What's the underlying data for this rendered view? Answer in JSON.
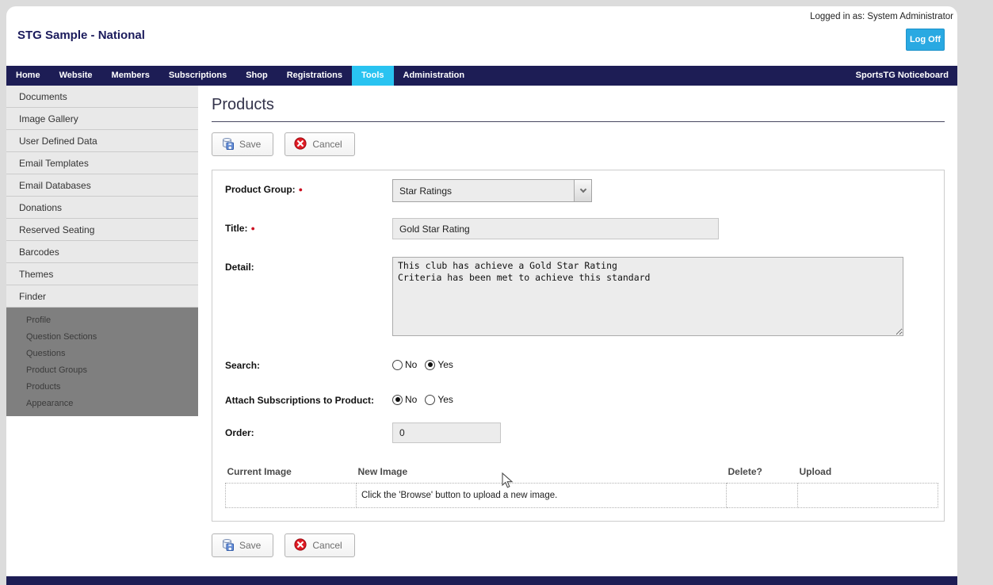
{
  "header": {
    "site_title": "STG Sample - National",
    "logged_in_text": "Logged in as: System Administrator",
    "log_off_label": "Log Off"
  },
  "navbar": {
    "items": [
      "Home",
      "Website",
      "Members",
      "Subscriptions",
      "Shop",
      "Registrations",
      "Tools",
      "Administration"
    ],
    "active_item": "Tools",
    "noticeboard_label": "SportsTG Noticeboard"
  },
  "sidebar": {
    "items": [
      "Documents",
      "Image Gallery",
      "User Defined Data",
      "Email Templates",
      "Email Databases",
      "Donations",
      "Reserved Seating",
      "Barcodes",
      "Themes",
      "Finder"
    ],
    "finder_subitems": [
      "Profile",
      "Question Sections",
      "Questions",
      "Product Groups",
      "Products",
      "Appearance"
    ]
  },
  "main": {
    "heading": "Products",
    "toolbar": {
      "save_label": "Save",
      "cancel_label": "Cancel"
    },
    "required_marker": "●",
    "form": {
      "product_group_label": "Product Group:",
      "product_group_value": "Star Ratings",
      "title_label": "Title:",
      "title_value": "Gold Star Rating",
      "detail_label": "Detail:",
      "detail_value": "This club has achieve a Gold Star Rating\nCriteria has been met to achieve this standard",
      "search_label": "Search:",
      "search_option_no": "No",
      "search_option_yes": "Yes",
      "search_selected": "Yes",
      "attach_label": "Attach Subscriptions to Product:",
      "attach_option_no": "No",
      "attach_option_yes": "Yes",
      "attach_selected": "No",
      "order_label": "Order:",
      "order_value": "0"
    },
    "image_table": {
      "headers": [
        "Current Image",
        "New Image",
        "Delete?",
        "Upload"
      ],
      "row_message": "Click the 'Browse' button to upload a new image."
    }
  },
  "colors": {
    "navy": "#1d1d55",
    "active_tab_cyan": "#29c3f1",
    "log_off_cyan": "#29a9e2",
    "required_red": "#cc1122",
    "sidebar_gray": "#e9e9e9",
    "subnav_gray": "#7f7f7f"
  }
}
